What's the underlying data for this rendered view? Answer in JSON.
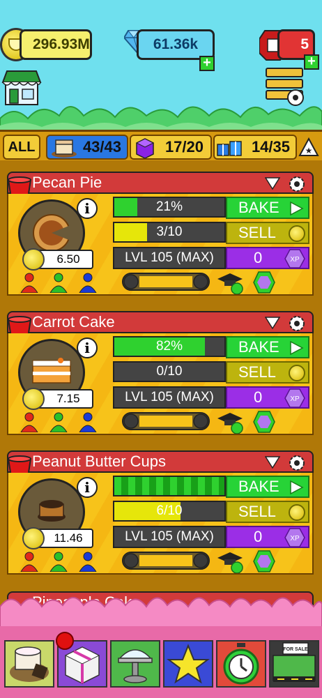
{
  "currency": {
    "coins": "296.93M",
    "gems": "61.36k",
    "tickets": "5"
  },
  "tabs": [
    {
      "label": "ALL",
      "count": ""
    },
    {
      "label": "",
      "count": "43/43"
    },
    {
      "label": "",
      "count": "17/20"
    },
    {
      "label": "",
      "count": "14/35"
    }
  ],
  "products": [
    {
      "name": "Pecan Pie",
      "price": "6.50",
      "progress_text": "21%",
      "progress": 0.21,
      "progress_color": "#2fd12f",
      "stock_text": "3/10",
      "stock": 0.3,
      "stock_color": "#e6e60a",
      "level": "LVL 105 (MAX)",
      "xp": "0",
      "bake_label": "BAKE",
      "sell_label": "SELL",
      "xp_label": "XP"
    },
    {
      "name": "Carrot Cake",
      "price": "7.15",
      "progress_text": "82%",
      "progress": 0.82,
      "progress_color": "#2fd12f",
      "stock_text": "0/10",
      "stock": 0,
      "stock_color": "#e6e60a",
      "level": "LVL 105 (MAX)",
      "xp": "0",
      "bake_label": "BAKE",
      "sell_label": "SELL",
      "xp_label": "XP"
    },
    {
      "name": "Peanut Butter Cups",
      "price": "11.46",
      "progress_text": "",
      "progress": 1,
      "progress_color": "#2fd12f",
      "stock_text": "6/10",
      "stock": 0.6,
      "stock_color": "#e6e60a",
      "level": "LVL 105 (MAX)",
      "xp": "0",
      "bake_label": "BAKE",
      "sell_label": "SELL",
      "xp_label": "XP"
    }
  ],
  "partial_product": {
    "name": "Pineapple Cake"
  },
  "colors": {
    "header_red": "#d23a3a",
    "bake_green": "#27d337",
    "sell_olive": "#bdb40e",
    "xp_purple": "#9b2ee6"
  }
}
